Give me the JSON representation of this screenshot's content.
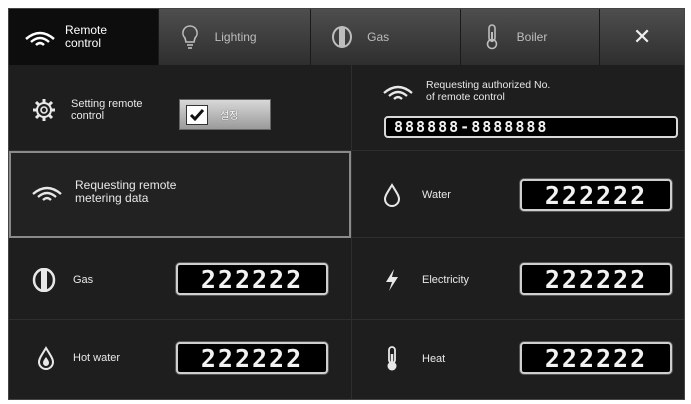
{
  "tabs": {
    "remote_control": "Remote\ncontrol",
    "lighting": "Lighting",
    "gas": "Gas",
    "boiler": "Boiler",
    "close": "✕"
  },
  "setting": {
    "label": "Setting remote\ncontrol",
    "button_label": "설정",
    "checked": true
  },
  "auth": {
    "label": "Requesting authorized No.\nof remote control",
    "value": "888888-8888888"
  },
  "request": {
    "label": "Requesting remote\nmetering data"
  },
  "meters": {
    "water": {
      "label": "Water",
      "value": "222222"
    },
    "gas": {
      "label": "Gas",
      "value": "222222"
    },
    "electricity": {
      "label": "Electricity",
      "value": "222222"
    },
    "hot_water": {
      "label": "Hot water",
      "value": "222222"
    },
    "heat": {
      "label": "Heat",
      "value": "222222"
    }
  },
  "colors": {
    "background": "#1a1a1a",
    "active_tab": "#0d0d0d",
    "lcd_border": "#cfcfcf"
  }
}
